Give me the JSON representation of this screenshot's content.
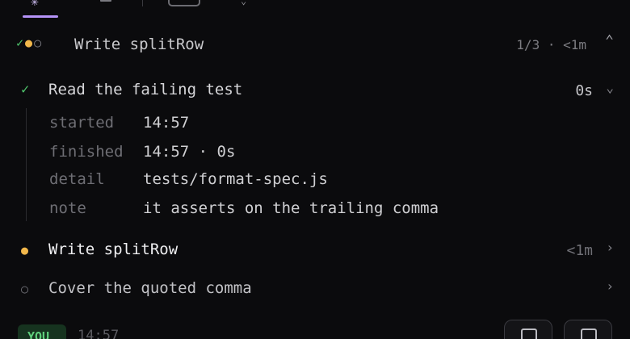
{
  "summary": {
    "icon_done": "✓",
    "icon_current": "●",
    "icon_todo": "○",
    "title": "Write splitRow",
    "progress": "1/3 · <1m"
  },
  "steps": [
    {
      "status_icon": "✓",
      "label": "Read the failing test",
      "duration": "0s",
      "details": [
        {
          "key": "started",
          "value": "14:57"
        },
        {
          "key": "finished",
          "value": "14:57 · 0s"
        },
        {
          "key": "detail",
          "value": "tests/format-spec.js"
        },
        {
          "key": "note",
          "value": "it asserts on the trailing comma"
        }
      ]
    },
    {
      "status_icon": "●",
      "label": "Write splitRow",
      "duration": "<1m"
    },
    {
      "status_icon": "○",
      "label": "Cover the quoted comma",
      "duration": ""
    }
  ],
  "message": {
    "author_badge": "YOU",
    "time": "14:57"
  },
  "colors": {
    "done": "#4ec36b",
    "current": "#f2b84b",
    "todo": "#7a7a80",
    "accent": "#b593f7"
  }
}
